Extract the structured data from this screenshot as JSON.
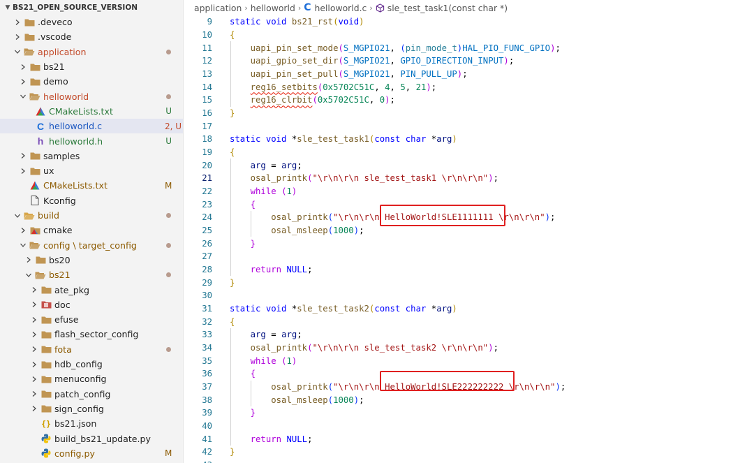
{
  "explorer": {
    "root_label": "BS21_OPEN_SOURCE_VERSION",
    "items": [
      {
        "label": "deveco_display",
        "text": ".deveco",
        "depth": 1,
        "kind": "folder",
        "open": false,
        "status": "",
        "state": ""
      },
      {
        "label": "vscode",
        "text": ".vscode",
        "depth": 1,
        "kind": "folder",
        "open": false,
        "status": "",
        "state": ""
      },
      {
        "label": "application",
        "text": "application",
        "depth": 1,
        "kind": "folder",
        "open": true,
        "status": "dot",
        "state": "app"
      },
      {
        "label": "bs21",
        "text": "bs21",
        "depth": 2,
        "kind": "folder",
        "open": false,
        "status": "",
        "state": ""
      },
      {
        "label": "demo",
        "text": "demo",
        "depth": 2,
        "kind": "folder",
        "open": false,
        "status": "",
        "state": ""
      },
      {
        "label": "helloworld",
        "text": "helloworld",
        "depth": 2,
        "kind": "folder",
        "open": true,
        "status": "dot",
        "state": "app"
      },
      {
        "label": "cmakelists-hw",
        "text": "CMakeLists.txt",
        "depth": 3,
        "kind": "cmake",
        "open": null,
        "status": "U",
        "state": "untracked"
      },
      {
        "label": "helloworld-c",
        "text": "helloworld.c",
        "depth": 3,
        "kind": "c",
        "open": null,
        "status": "2, U",
        "state": "err",
        "selected": true
      },
      {
        "label": "helloworld-h",
        "text": "helloworld.h",
        "depth": 3,
        "kind": "h",
        "open": null,
        "status": "U",
        "state": "untracked"
      },
      {
        "label": "samples",
        "text": "samples",
        "depth": 2,
        "kind": "folder",
        "open": false,
        "status": "",
        "state": ""
      },
      {
        "label": "ux",
        "text": "ux",
        "depth": 2,
        "kind": "folder",
        "open": false,
        "status": "",
        "state": ""
      },
      {
        "label": "cmakelists-app",
        "text": "CMakeLists.txt",
        "depth": 2,
        "kind": "cmake",
        "open": null,
        "status": "M",
        "state": "mod"
      },
      {
        "label": "kconfig",
        "text": "Kconfig",
        "depth": 2,
        "kind": "file",
        "open": null,
        "status": "",
        "state": ""
      },
      {
        "label": "build",
        "text": "build",
        "depth": 1,
        "kind": "build-folder",
        "open": true,
        "status": "dot",
        "state": "mod"
      },
      {
        "label": "cmake",
        "text": "cmake",
        "depth": 2,
        "kind": "cmake-folder",
        "open": false,
        "status": "",
        "state": ""
      },
      {
        "label": "config-target",
        "text": "config \\ target_config",
        "depth": 2,
        "kind": "folder",
        "open": true,
        "status": "dot",
        "state": "mod"
      },
      {
        "label": "bs20",
        "text": "bs20",
        "depth": 3,
        "kind": "folder",
        "open": false,
        "status": "",
        "state": ""
      },
      {
        "label": "bs21-cfg",
        "text": "bs21",
        "depth": 3,
        "kind": "folder",
        "open": true,
        "status": "dot",
        "state": "mod"
      },
      {
        "label": "ate-pkg",
        "text": "ate_pkg",
        "depth": 4,
        "kind": "folder",
        "open": false,
        "status": "",
        "state": ""
      },
      {
        "label": "doc",
        "text": "doc",
        "depth": 4,
        "kind": "doc-folder",
        "open": false,
        "status": "",
        "state": ""
      },
      {
        "label": "efuse",
        "text": "efuse",
        "depth": 4,
        "kind": "folder",
        "open": false,
        "status": "",
        "state": ""
      },
      {
        "label": "flash-sector",
        "text": "flash_sector_config",
        "depth": 4,
        "kind": "folder",
        "open": false,
        "status": "",
        "state": ""
      },
      {
        "label": "fota",
        "text": "fota",
        "depth": 4,
        "kind": "folder",
        "open": false,
        "status": "dot",
        "state": "mod"
      },
      {
        "label": "hdb-config",
        "text": "hdb_config",
        "depth": 4,
        "kind": "folder",
        "open": false,
        "status": "",
        "state": ""
      },
      {
        "label": "menuconfig",
        "text": "menuconfig",
        "depth": 4,
        "kind": "folder",
        "open": false,
        "status": "",
        "state": ""
      },
      {
        "label": "patch-config",
        "text": "patch_config",
        "depth": 4,
        "kind": "folder",
        "open": false,
        "status": "",
        "state": ""
      },
      {
        "label": "sign-config",
        "text": "sign_config",
        "depth": 4,
        "kind": "folder",
        "open": false,
        "status": "",
        "state": ""
      },
      {
        "label": "bs21-json",
        "text": "bs21.json",
        "depth": 4,
        "kind": "json",
        "open": null,
        "status": "",
        "state": ""
      },
      {
        "label": "build-update-py",
        "text": "build_bs21_update.py",
        "depth": 4,
        "kind": "py",
        "open": null,
        "status": "",
        "state": ""
      },
      {
        "label": "config-py",
        "text": "config.py",
        "depth": 4,
        "kind": "py",
        "open": null,
        "status": "M",
        "state": "mod"
      }
    ]
  },
  "breadcrumb": {
    "seg1": "application",
    "seg2": "helloworld",
    "seg3": "helloworld.c",
    "seg4": "sle_test_task1(const char *)"
  },
  "editor": {
    "active_line": 21,
    "lines": [
      {
        "n": "9",
        "html": "<span class='kw'>static</span> <span class='kw'>void</span> <span class='fn'>bs21_rst</span><span class='brY'>(</span><span class='kw'>void</span><span class='brY'>)</span>"
      },
      {
        "n": "10",
        "html": "<span class='brY'>{</span>"
      },
      {
        "n": "11",
        "html": "    <span class='fn'>uapi_pin_set_mode</span><span class='kc'>(</span><span class='mc'>S_MGPIO21</span>, <span class='br1'>(</span><span class='ty'>pin_mode_t</span><span class='br1'>)</span><span class='mc'>HAL_PIO_FUNC_GPIO</span><span class='kc'>)</span>;"
      },
      {
        "n": "12",
        "html": "    <span class='fn'>uapi_gpio_set_dir</span><span class='kc'>(</span><span class='mc'>S_MGPIO21</span>, <span class='mc'>GPIO_DIRECTION_INPUT</span><span class='kc'>)</span>;"
      },
      {
        "n": "13",
        "html": "    <span class='fn'>uapi_pin_set_pull</span><span class='kc'>(</span><span class='mc'>S_MGPIO21</span>, <span class='mc'>PIN_PULL_UP</span><span class='kc'>)</span>;"
      },
      {
        "n": "14",
        "html": "    <span class='fn squig'>reg16_setbits</span><span class='kc'>(</span><span class='nm'>0x5702C51C</span>, <span class='nm'>4</span>, <span class='nm'>5</span>, <span class='nm'>21</span><span class='kc'>)</span>;"
      },
      {
        "n": "15",
        "html": "    <span class='fn squig'>reg16_clrbit</span><span class='kc'>(</span><span class='nm'>0x5702C51C</span>, <span class='nm'>0</span><span class='kc'>)</span>;"
      },
      {
        "n": "16",
        "html": "<span class='brY'>}</span>"
      },
      {
        "n": "17",
        "html": ""
      },
      {
        "n": "18",
        "html": "<span class='kw'>static</span> <span class='kw'>void</span> *<span class='fn'>sle_test_task1</span><span class='brY'>(</span><span class='kw'>const</span> <span class='kw'>char</span> *<span class='pa'>arg</span><span class='brY'>)</span>"
      },
      {
        "n": "19",
        "html": "<span class='brY'>{</span>"
      },
      {
        "n": "20",
        "html": "    <span class='pa'>arg</span> = <span class='pa'>arg</span>;"
      },
      {
        "n": "21",
        "html": "    <span class='fn'>osal_printk</span><span class='kc'>(</span><span class='st'>\"\\r\\n\\r\\n sle_test_task1 \\r\\n\\r\\n\"</span><span class='kc'>)</span>;"
      },
      {
        "n": "22",
        "html": "    <span class='kc'>while</span> <span class='kc'>(</span><span class='nm'>1</span><span class='kc'>)</span>"
      },
      {
        "n": "23",
        "html": "    <span class='kc'>{</span>"
      },
      {
        "n": "24",
        "html": "        <span class='fn'>osal_printk</span><span class='br1'>(</span><span class='st'>\"\\r\\n\\r\\n HelloWorld!SLE1111111 \\r\\n\\r\\n\"</span><span class='br1'>)</span>;"
      },
      {
        "n": "25",
        "html": "        <span class='fn'>osal_msleep</span><span class='br1'>(</span><span class='nm'>1000</span><span class='br1'>)</span>;"
      },
      {
        "n": "26",
        "html": "    <span class='kc'>}</span>"
      },
      {
        "n": "27",
        "html": ""
      },
      {
        "n": "28",
        "html": "    <span class='kc'>return</span> <span class='kw'>NULL</span>;"
      },
      {
        "n": "29",
        "html": "<span class='brY'>}</span>"
      },
      {
        "n": "30",
        "html": ""
      },
      {
        "n": "31",
        "html": "<span class='kw'>static</span> <span class='kw'>void</span> *<span class='fn'>sle_test_task2</span><span class='brY'>(</span><span class='kw'>const</span> <span class='kw'>char</span> *<span class='pa'>arg</span><span class='brY'>)</span>"
      },
      {
        "n": "32",
        "html": "<span class='brY'>{</span>"
      },
      {
        "n": "33",
        "html": "    <span class='pa'>arg</span> = <span class='pa'>arg</span>;"
      },
      {
        "n": "34",
        "html": "    <span class='fn'>osal_printk</span><span class='kc'>(</span><span class='st'>\"\\r\\n\\r\\n sle_test_task2 \\r\\n\\r\\n\"</span><span class='kc'>)</span>;"
      },
      {
        "n": "35",
        "html": "    <span class='kc'>while</span> <span class='kc'>(</span><span class='nm'>1</span><span class='kc'>)</span>"
      },
      {
        "n": "36",
        "html": "    <span class='kc'>{</span>"
      },
      {
        "n": "37",
        "html": "        <span class='fn'>osal_printk</span><span class='br1'>(</span><span class='st'>\"\\r\\n\\r\\n HelloWorld!SLE222222222 \\r\\n\\r\\n\"</span><span class='br1'>)</span>;"
      },
      {
        "n": "38",
        "html": "        <span class='fn'>osal_msleep</span><span class='br1'>(</span><span class='nm'>1000</span><span class='br1'>)</span>;"
      },
      {
        "n": "39",
        "html": "    <span class='kc'>}</span>"
      },
      {
        "n": "40",
        "html": ""
      },
      {
        "n": "41",
        "html": "    <span class='kc'>return</span> <span class='kw'>NULL</span>;"
      },
      {
        "n": "42",
        "html": "<span class='brY'>}</span>"
      },
      {
        "n": "43",
        "html": ""
      }
    ]
  },
  "colors": {
    "accent_c_icon": "#1e6fd9",
    "folder": "#c09553",
    "highlight_box": "#e02020"
  }
}
